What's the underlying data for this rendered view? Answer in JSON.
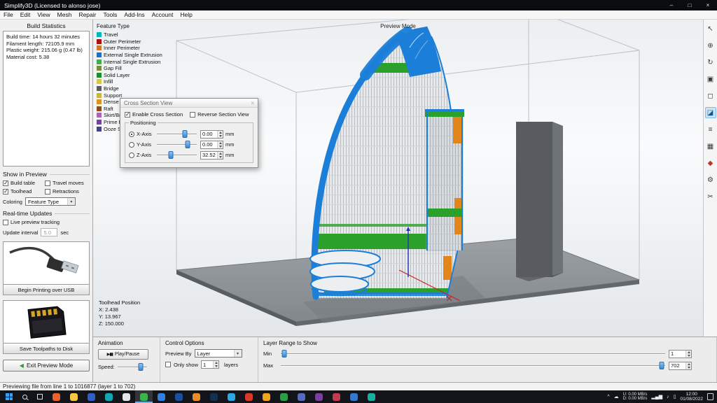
{
  "window": {
    "title": "Simplify3D (Licensed to alonso jose)",
    "minimize_glyph": "–",
    "maximize_glyph": "□",
    "close_glyph": "×"
  },
  "menu": {
    "items": [
      "File",
      "Edit",
      "View",
      "Mesh",
      "Repair",
      "Tools",
      "Add-Ins",
      "Account",
      "Help"
    ]
  },
  "sidebar": {
    "build_statistics": {
      "title": "Build Statistics",
      "stats": [
        "Build time: 14 hours 32 minutes",
        "Filament length: 72105.9 mm",
        "Plastic weight: 215.06 g (0.47 lb)",
        "Material cost: 5.38"
      ]
    },
    "show_in_preview": {
      "title": "Show in Preview",
      "options": [
        {
          "label": "Build table",
          "checked": true
        },
        {
          "label": "Travel moves",
          "checked": false
        },
        {
          "label": "Toolhead",
          "checked": true
        },
        {
          "label": "Retractions",
          "checked": false
        }
      ],
      "coloring_label": "Coloring",
      "coloring_value": "Feature Type"
    },
    "realtime_updates": {
      "title": "Real-time Updates",
      "live_preview_label": "Live preview tracking",
      "live_preview_checked": false,
      "update_interval_label": "Update interval",
      "update_interval_value": "5.0",
      "update_interval_unit": "sec"
    },
    "usb_button_label": "Begin Printing over USB",
    "disk_button_label": "Save Toolpaths to Disk",
    "exit_button_label": "Exit Preview Mode",
    "exit_arrow_glyph": "◀"
  },
  "viewport": {
    "preview_mode_label": "Preview Mode",
    "legend": {
      "title": "Feature Type",
      "items": [
        {
          "label": "Travel",
          "color": "#00b5bd"
        },
        {
          "label": "Outer Perimeter",
          "color": "#aa1111"
        },
        {
          "label": "Inner Perimeter",
          "color": "#e07318"
        },
        {
          "label": "External Single Extrusion",
          "color": "#1a72c8"
        },
        {
          "label": "Internal Single Extrusion",
          "color": "#3faf4a"
        },
        {
          "label": "Gap Fill",
          "color": "#7d8c3c"
        },
        {
          "label": "Solid Layer",
          "color": "#1e8b2e"
        },
        {
          "label": "Infill",
          "color": "#d9c930"
        },
        {
          "label": "Bridge",
          "color": "#5d5d5d"
        },
        {
          "label": "Support",
          "color": "#c9b832"
        },
        {
          "label": "Dense Support",
          "color": "#e2901f"
        },
        {
          "label": "Raft",
          "color": "#8a4a20"
        },
        {
          "label": "Skirt/Brim",
          "color": "#b85abf"
        },
        {
          "label": "Prime Pillar",
          "color": "#7a3fa8"
        },
        {
          "label": "Ooze Shield",
          "color": "#4a3f8f"
        }
      ]
    },
    "toolhead_position": {
      "title": "Toolhead Position",
      "x": "X: 2.438",
      "y": "Y: 13.967",
      "z": "Z: 150.000"
    },
    "cross_section_dialog": {
      "title": "Cross Section View",
      "close_glyph": "×",
      "enable_label": "Enable Cross Section",
      "enable_checked": true,
      "reverse_label": "Reverse Section View",
      "reverse_checked": false,
      "positioning_label": "Positioning",
      "axes": [
        {
          "label": "X-Axis",
          "value": "0.00",
          "unit": "mm",
          "selected": true
        },
        {
          "label": "Y-Axis",
          "value": "0.00",
          "unit": "mm",
          "selected": false
        },
        {
          "label": "Z-Axis",
          "value": "32.52",
          "unit": "mm",
          "selected": false
        }
      ]
    }
  },
  "tool_rail": {
    "tools": [
      {
        "name": "select",
        "glyph": "↖"
      },
      {
        "name": "zoom",
        "glyph": "⊕"
      },
      {
        "name": "rotate-view",
        "glyph": "↻"
      },
      {
        "name": "fit-view",
        "glyph": "▣"
      },
      {
        "name": "snapshot",
        "glyph": "◻"
      },
      {
        "name": "cross-section",
        "glyph": "◪",
        "active": true
      },
      {
        "name": "layers",
        "glyph": "≡"
      },
      {
        "name": "mesh",
        "glyph": "▦"
      },
      {
        "name": "supports",
        "glyph": "◆",
        "accent": true
      },
      {
        "name": "settings",
        "glyph": "⚙"
      },
      {
        "name": "cut",
        "glyph": "✂"
      }
    ]
  },
  "bottom_panel": {
    "animation": {
      "title": "Animation",
      "play_icon": "▶▮▮",
      "play_label": "Play/Pause",
      "speed_label": "Speed:"
    },
    "control_options": {
      "title": "Control Options",
      "preview_by_label": "Preview By",
      "preview_by_value": "Layer",
      "only_show_label": "Only show",
      "only_show_value": "1",
      "only_show_checked": false,
      "layers_label": "layers"
    },
    "layer_range": {
      "title": "Layer Range to Show",
      "min_label": "Min",
      "min_value": "1",
      "max_label": "Max",
      "max_value": "702"
    }
  },
  "status_bar": {
    "text": "Previewing file from line 1 to 1016877 (layer 1 to 702)"
  },
  "taskbar": {
    "apps": [
      {
        "color": "#e8622c"
      },
      {
        "color": "#f6c644"
      },
      {
        "color": "#2f5fc4"
      },
      {
        "color": "#12a5b4"
      },
      {
        "color": "#e3e6e8"
      },
      {
        "color": "#3cb44e",
        "active": true
      },
      {
        "color": "#2f80e0"
      },
      {
        "color": "#1d4e9e"
      },
      {
        "color": "#ea8a2a"
      },
      {
        "color": "#12314e"
      },
      {
        "color": "#2aa8e0"
      },
      {
        "color": "#d9392b"
      },
      {
        "color": "#f2a41c"
      },
      {
        "color": "#2e9e46"
      },
      {
        "color": "#566ac0"
      },
      {
        "color": "#7c3fa0"
      },
      {
        "color": "#c33a52"
      },
      {
        "color": "#3578c8"
      },
      {
        "color": "#18b0a0"
      }
    ],
    "tray": {
      "expand_glyph": "^",
      "cloud_glyph": "☁",
      "net_up": "U: 0.00 MB/s",
      "net_down": "D: 0.00 MB/s",
      "signal_glyph": "▂▄▆",
      "volume_glyph": "♪",
      "battery_glyph": "▯",
      "time": "12:00",
      "date": "01/08/2022"
    }
  }
}
